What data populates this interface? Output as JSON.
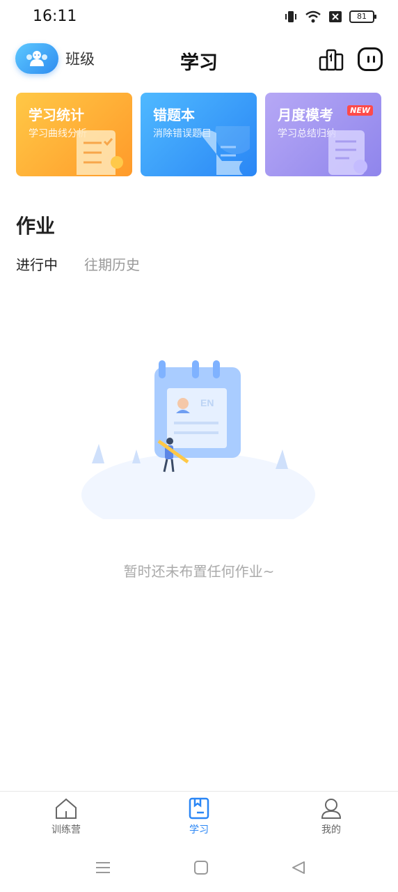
{
  "status": {
    "time": "16:11",
    "battery": "81"
  },
  "header": {
    "class_label": "班级",
    "title": "学习"
  },
  "cards": [
    {
      "title": "学习统计",
      "subtitle": "学习曲线分析"
    },
    {
      "title": "错题本",
      "subtitle": "消除错误题目"
    },
    {
      "title": "月度模考",
      "subtitle": "学习总结归纳",
      "badge": "NEW"
    }
  ],
  "homework": {
    "title": "作业",
    "tabs": [
      "进行中",
      "往期历史"
    ],
    "illustration_label": "EN",
    "empty_text": "暂时还未布置任何作业~"
  },
  "bottom_nav": [
    {
      "label": "训练营",
      "icon": "home-icon"
    },
    {
      "label": "学习",
      "icon": "book-icon",
      "active": true
    },
    {
      "label": "我的",
      "icon": "profile-icon"
    }
  ],
  "colors": {
    "accent": "#2a86f5",
    "stats_card": "#ff9a2a",
    "wrong_card": "#2a86f5",
    "month_card": "#8f85ec"
  }
}
